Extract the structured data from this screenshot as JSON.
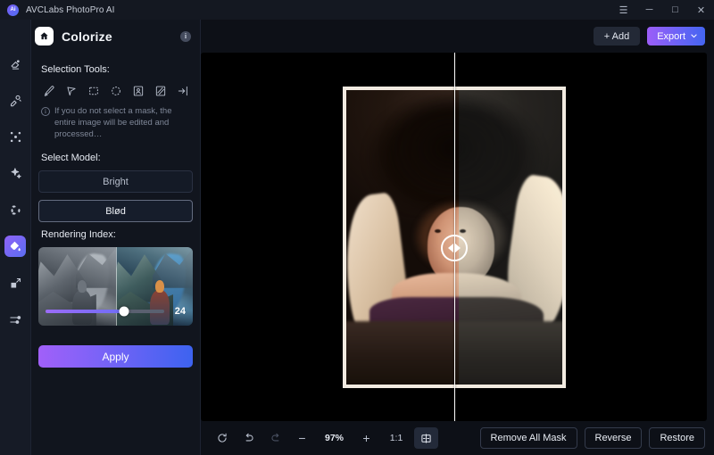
{
  "window": {
    "app_title": "AVCLabs PhotoPro AI",
    "logo_text": "Ai",
    "controls": [
      {
        "name": "menu",
        "glyph": "☰"
      },
      {
        "name": "minimize",
        "glyph": "─"
      },
      {
        "name": "maximize",
        "glyph": "□"
      },
      {
        "name": "close",
        "glyph": "✕"
      }
    ]
  },
  "rail": {
    "items": [
      {
        "name": "eraser-tool",
        "active": false
      },
      {
        "name": "object-remove-tool",
        "active": false
      },
      {
        "name": "enhance-tool",
        "active": false
      },
      {
        "name": "retouch-tool",
        "active": false
      },
      {
        "name": "background-tool",
        "active": false
      },
      {
        "name": "colorize-tool",
        "active": true
      },
      {
        "name": "upscale-tool",
        "active": false
      },
      {
        "name": "adjust-tool",
        "active": false
      }
    ]
  },
  "panel": {
    "home_icon": "home-icon",
    "title": "Colorize",
    "info_icon": "i",
    "selection_tools_label": "Selection Tools:",
    "tools": [
      {
        "name": "brush-tool"
      },
      {
        "name": "lasso-pointer-tool"
      },
      {
        "name": "rectangle-select-tool"
      },
      {
        "name": "ellipse-select-tool"
      },
      {
        "name": "subject-select-tool"
      },
      {
        "name": "invert-mask-tool"
      },
      {
        "name": "import-mask-tool"
      }
    ],
    "hint_icon": "i",
    "hint_text": "If you do not select a mask, the entire image will be edited and processed…",
    "select_model_label": "Select Model:",
    "models": [
      {
        "label": "Bright",
        "selected": false
      },
      {
        "label": "Blød",
        "selected": true
      }
    ],
    "rendering_index_label": "Rendering Index:",
    "rendering_index_value": "24",
    "rendering_index_percent": 66,
    "apply_label": "Apply"
  },
  "main": {
    "add_label": "+ Add",
    "export_label": "Export",
    "export_caret": "⌄"
  },
  "bottombar": {
    "reset_icon": "rotate-icon",
    "undo_icon": "undo-icon",
    "redo_icon": "redo-icon",
    "zoom_out_label": "−",
    "zoom_level": "97%",
    "zoom_in_label": "+",
    "fit_label": "1:1",
    "compare_icon": "compare-icon",
    "actions": [
      {
        "label": "Remove All Mask",
        "name": "remove-all-mask-button"
      },
      {
        "label": "Reverse",
        "name": "reverse-button"
      },
      {
        "label": "Restore",
        "name": "restore-button"
      }
    ]
  },
  "colors": {
    "accent_purple": "#9c5ef8",
    "accent_blue": "#4465f1",
    "panel_bg": "#11151e",
    "rail_bg": "#161b26",
    "canvas_bg": "#000000"
  }
}
